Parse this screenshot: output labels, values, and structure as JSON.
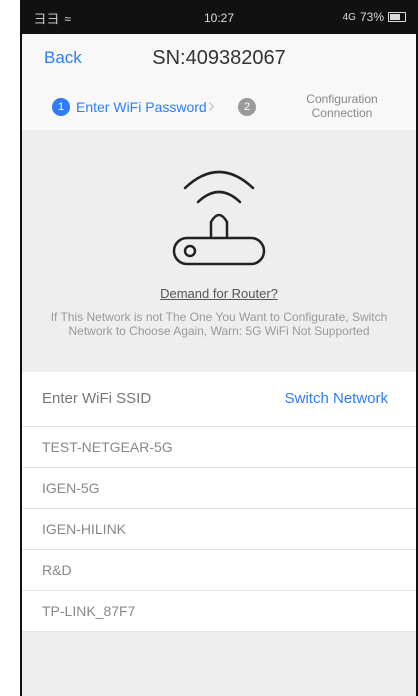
{
  "status_bar": {
    "signal": "彐彐 ≈",
    "time": "10:27",
    "battery_pct": "73%",
    "network_badge": "4G"
  },
  "nav": {
    "back_label": "Back",
    "title": "SN:409382067"
  },
  "steps": [
    {
      "number": "1",
      "label": "Enter WiFi Password"
    },
    {
      "number": "2",
      "label": "Configuration Connection"
    }
  ],
  "router": {
    "demand_link": "Demand for Router?",
    "warning": "If This Network is not The One You Want to Configurate, Switch Network to Choose Again, Warn: 5G WiFi Not Supported"
  },
  "wifi": {
    "ssid_placeholder": "Enter WiFi SSID",
    "switch_label": "Switch Network",
    "networks": [
      "TEST-NETGEAR-5G",
      "IGEN-5G",
      "IGEN-HILINK",
      "R&D",
      "TP-LINK_87F7"
    ]
  },
  "colors": {
    "accent": "#2f7cf6",
    "background": "#efeeee"
  }
}
